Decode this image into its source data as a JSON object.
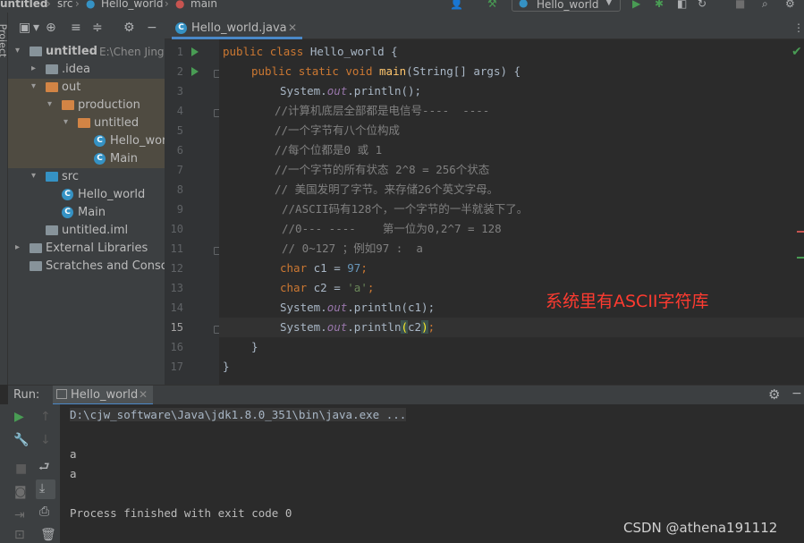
{
  "topbar": {
    "project": "untitled",
    "src": "src",
    "file": "Hello_world",
    "method": "main",
    "run_config": "Hello_world"
  },
  "toolstrip": {
    "label": "Project"
  },
  "project_tree": [
    {
      "label": "untitled",
      "path": "E:\\Chen Jingw",
      "arrow": "▾",
      "bold": true,
      "hl": false,
      "icon": "module-folder"
    },
    {
      "label": ".idea",
      "arrow": "▸",
      "hl": false,
      "icon": "folder"
    },
    {
      "label": "out",
      "arrow": "▾",
      "hl": true,
      "icon": "folder-excluded"
    },
    {
      "label": "production",
      "arrow": "▾",
      "hl": true,
      "icon": "folder-excluded"
    },
    {
      "label": "untitled",
      "arrow": "▾",
      "hl": true,
      "icon": "folder-excluded"
    },
    {
      "label": "Hello_worl",
      "hl": true,
      "icon": "class"
    },
    {
      "label": "Main",
      "hl": true,
      "icon": "class"
    },
    {
      "label": "src",
      "arrow": "▾",
      "hl": false,
      "icon": "source-folder"
    },
    {
      "label": "Hello_world",
      "hl": false,
      "icon": "class"
    },
    {
      "label": "Main",
      "hl": false,
      "icon": "class"
    },
    {
      "label": "untitled.iml",
      "hl": false,
      "icon": "iml-file"
    },
    {
      "label": "External Libraries",
      "arrow": "▸",
      "hl": false,
      "icon": "libraries"
    },
    {
      "label": "Scratches and Console",
      "hl": false,
      "icon": "scratches"
    }
  ],
  "editor": {
    "tab_label": "Hello_world.java",
    "current_line": 15,
    "line_numbers": [
      "1",
      "2",
      "3",
      "4",
      "5",
      "6",
      "7",
      "8",
      "9",
      "10",
      "11",
      "12",
      "13",
      "14",
      "15",
      "16",
      "17"
    ],
    "code": {
      "l1_kw1": "public",
      "l1_kw2": "class",
      "l1_rest": " Hello_world {",
      "l2_kw1": "public",
      "l2_kw2": "static",
      "l2_kw3": "void",
      "l2_name": "main",
      "l2_rest": "(String[] args) {",
      "l3_a": "System.",
      "l3_out": "out",
      "l3_b": ".println();",
      "l4": "//计算机底层全部都是电信号----  ----",
      "l5": "//一个字节有八个位构成",
      "l6": "//每个位都是0 或 1",
      "l7": "//一个字节的所有状态 2^8 = 256个状态",
      "l8": "// 美国发明了字节。来存储26个英文字母。",
      "l9": "//ASCII码有128个，一个字节的一半就装下了。",
      "l10": "//0--- ----    第一位为0,2^7 = 128",
      "l11": "// 0~127 ；例如97 :  a",
      "l12_kw": "char",
      "l12_var": " c1 = ",
      "l12_val": "97",
      "l12_end": ";",
      "l13_kw": "char",
      "l13_var": " c2 = ",
      "l13_val": "'a'",
      "l13_end": ";",
      "l14_a": "System.",
      "l14_out": "out",
      "l14_b": ".println(c1);",
      "l15_a": "System.",
      "l15_out": "out",
      "l15_b": ".println",
      "l15_p1": "(",
      "l15_arg": "c2",
      "l15_p2": ")",
      "l15_end": ";",
      "l16": "}",
      "l17": "}"
    },
    "annotation": "系统里有ASCII字符库"
  },
  "run_panel": {
    "label": "Run:",
    "tab_label": "Hello_world",
    "console_lines": [
      "D:\\cjw_software\\Java\\jdk1.8.0_351\\bin\\java.exe ...",
      "",
      "a",
      "a",
      "",
      "Process finished with exit code 0"
    ]
  },
  "watermark": "CSDN @athena191112",
  "colors": {
    "keyword": "#cc7832",
    "comment": "#808080",
    "number": "#6897bb",
    "string": "#6a8759",
    "method": "#ffc66d",
    "field": "#9876aa",
    "annotation": "#ff3b30",
    "highlight_row": "#4f4b41",
    "run_green": "#499c54"
  }
}
